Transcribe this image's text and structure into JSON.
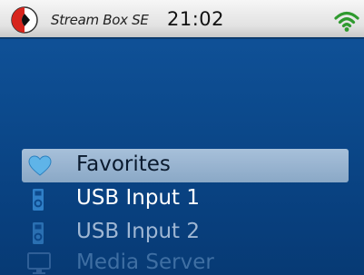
{
  "statusbar": {
    "device_name": "Stream Box SE",
    "time": "21:02",
    "logo_icon": "brand-logo-icon",
    "wifi_icon": "wifi-icon",
    "colors": {
      "logo_red": "#d7251d",
      "wifi_green": "#2f9a2f"
    }
  },
  "menu": {
    "items": [
      {
        "label": "Favorites",
        "icon": "heart-icon",
        "selected": true,
        "color": "#0a1a2e"
      },
      {
        "label": "USB Input 1",
        "icon": "usb-drive-icon",
        "selected": false,
        "color": "#ffffff"
      },
      {
        "label": "USB Input 2",
        "icon": "usb-drive-icon",
        "selected": false,
        "color": "#9fb7d4"
      },
      {
        "label": "Media Server",
        "icon": "monitor-icon",
        "selected": false,
        "color": "#3f6fa3"
      }
    ]
  },
  "colors": {
    "background": "#0c4a8d",
    "selection": "#9bb5d1",
    "statusbar": "#e6e6e6"
  }
}
